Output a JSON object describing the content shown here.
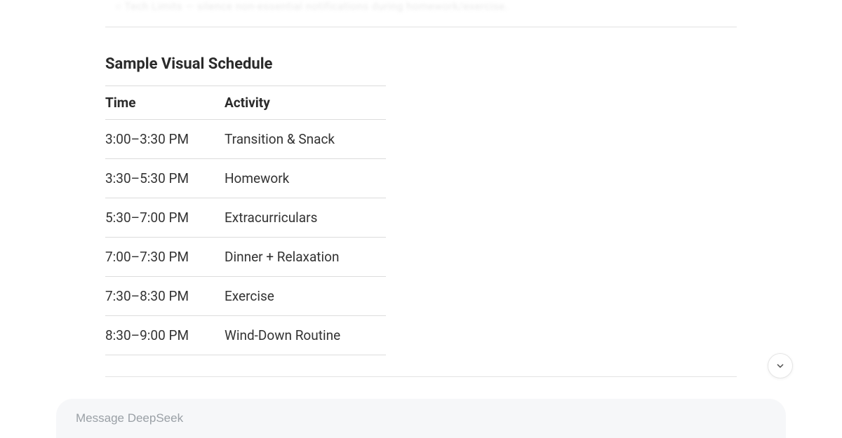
{
  "ghost_prev_text": "○  Tech Limits  — silence non-essential notifications during homework/exercise.",
  "section_title": "Sample Visual Schedule",
  "table": {
    "headers": {
      "time": "Time",
      "activity": "Activity"
    },
    "rows": [
      {
        "time": "3:00–3:30 PM",
        "activity": "Transition & Snack"
      },
      {
        "time": "3:30–5:30 PM",
        "activity": "Homework"
      },
      {
        "time": "5:30–7:00 PM",
        "activity": "Extracurriculars"
      },
      {
        "time": "7:00–7:30 PM",
        "activity": "Dinner + Relaxation"
      },
      {
        "time": "7:30–8:30 PM",
        "activity": "Exercise"
      },
      {
        "time": "8:30–9:00 PM",
        "activity": "Wind-Down Routine"
      }
    ]
  },
  "composer": {
    "placeholder": "Message DeepSeek"
  }
}
